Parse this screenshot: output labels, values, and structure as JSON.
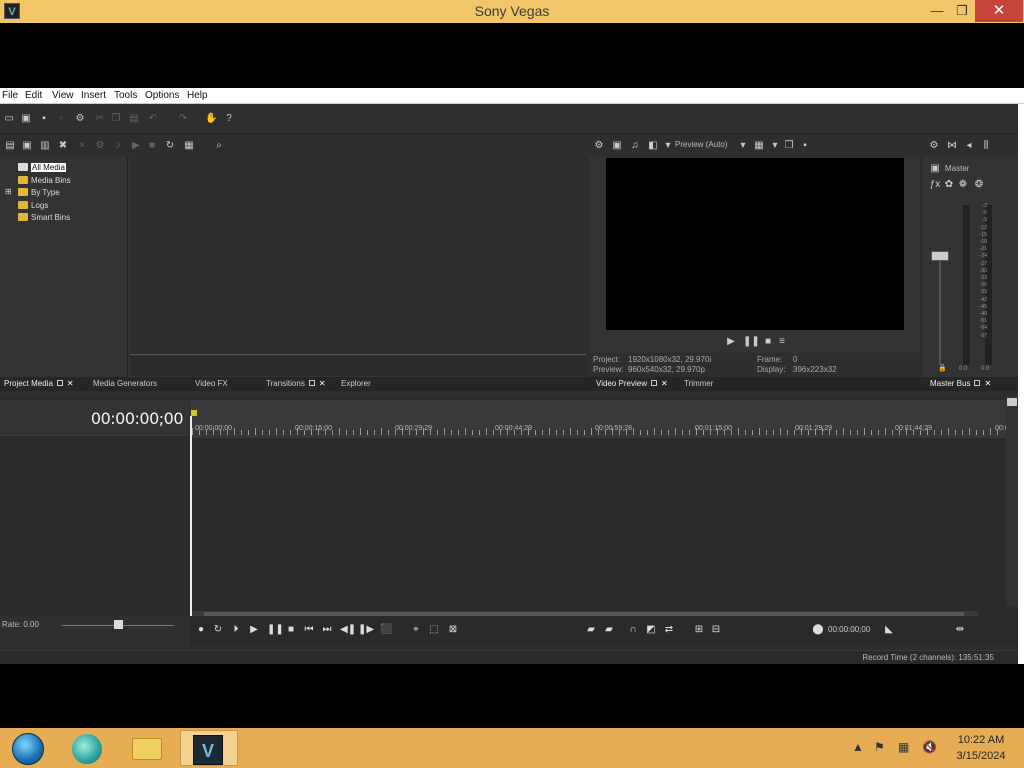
{
  "window": {
    "title": "Sony Vegas",
    "app_icon_letter": "V"
  },
  "menu": [
    "File",
    "Edit",
    "View",
    "Insert",
    "Tools",
    "Options",
    "Help"
  ],
  "project_media": {
    "tree": [
      "All Media",
      "Media Bins",
      "By Type",
      "Logs",
      "Smart Bins"
    ]
  },
  "preview": {
    "dropdown_label": "Preview (Auto)",
    "project_label": "Project:",
    "project_value": "1920x1080x32, 29.970i",
    "preview_label": "Preview:",
    "preview_value": "960x540x32, 29.970p",
    "frame_label": "Frame:",
    "frame_value": "0",
    "display_label": "Display:",
    "display_value": "396x223x32"
  },
  "master_bus": {
    "label": "Master",
    "scale": [
      "3",
      "6",
      "9",
      "12",
      "15",
      "18",
      "21",
      "24",
      "27",
      "30",
      "33",
      "36",
      "39",
      "42",
      "45",
      "48",
      "51",
      "54",
      "57"
    ],
    "left_value": "0.0",
    "right_value": "0.0"
  },
  "tabs": {
    "project_media": "Project Media",
    "media_generators": "Media Generators",
    "video_fx": "Video FX",
    "transitions": "Transitions",
    "explorer": "Explorer",
    "video_preview": "Video Preview",
    "trimmer": "Trimmer",
    "master_bus": "Master Bus"
  },
  "timeline": {
    "timecode": "00:00:00;00",
    "ruler_labels": [
      "00:00:00;00",
      "00:00:15;00",
      "00:00:29;29",
      "00:00:44;29",
      "00:00:59;28",
      "00:01:15;00",
      "00:01:29;29",
      "00:01:44;29",
      "00:01:"
    ]
  },
  "transport": {
    "rate": "Rate: 0.00",
    "position": "00:00:00;00"
  },
  "status": {
    "record_time": "Record Time (2 channels): 135:51:35"
  },
  "taskbar": {
    "time": "10:22 AM",
    "date": "3/15/2024"
  }
}
